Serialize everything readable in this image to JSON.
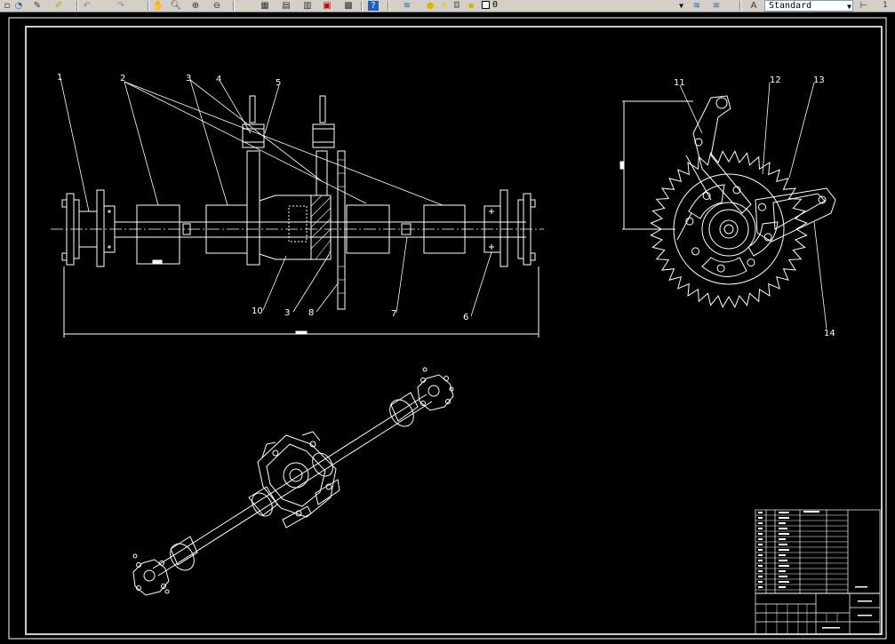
{
  "toolbar": {
    "layer_value": "0",
    "textstyle_value": "Standard",
    "right_edge_text": "1",
    "colors": {
      "background": "#d4d0c8",
      "accent_blue": "#1f5fbf",
      "bulb_yellow": "#ffe000"
    }
  },
  "drawing": {
    "balloons": [
      "1",
      "2",
      "3",
      "4",
      "5",
      "10",
      "3",
      "8",
      "7",
      "6",
      "11",
      "12",
      "13",
      "14"
    ],
    "colors": {
      "background": "#000000",
      "lines": "#ffffff"
    }
  },
  "title_block": {
    "colors": {
      "lines": "#ffffff"
    }
  }
}
